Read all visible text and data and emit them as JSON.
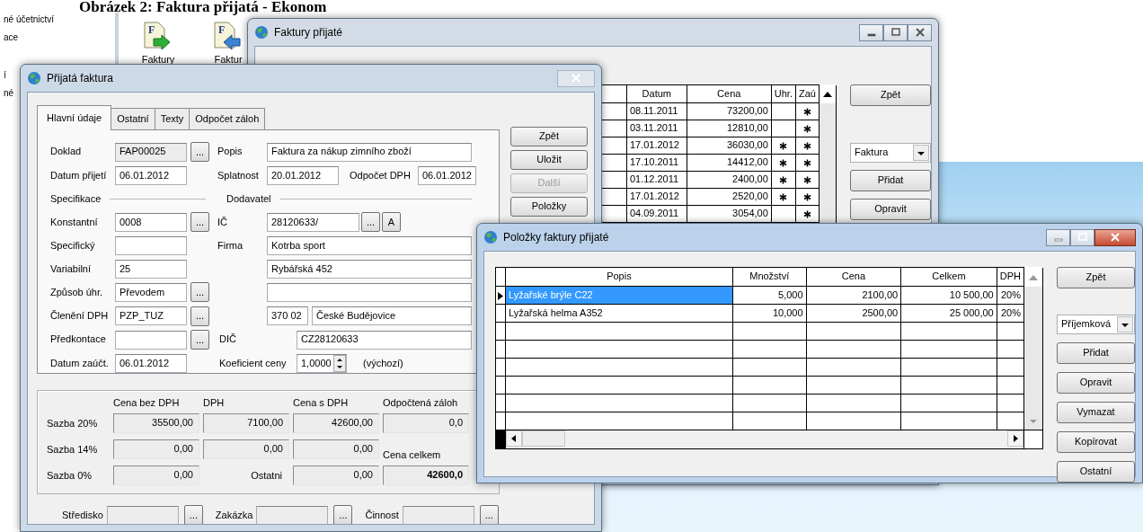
{
  "caption": "Obrázek 2: Faktura přijatá - Ekonom",
  "app": {
    "sidebar_items": [
      "né účetnictví",
      "ace",
      "í",
      "né"
    ],
    "toolbar": [
      {
        "label": "Faktury",
        "letter": "F",
        "kind": "out"
      },
      {
        "label": "Faktur",
        "letter": "F",
        "kind": "in"
      }
    ]
  },
  "invoices_window": {
    "title": "Faktury přijaté",
    "columns": [
      "Datum",
      "Cena",
      "Uhr.",
      "Zaú"
    ],
    "rows": [
      {
        "date": "08.11.2011",
        "price": "73200,00",
        "paid": false,
        "posted": true
      },
      {
        "date": "03.11.2011",
        "price": "12810,00",
        "paid": false,
        "posted": true
      },
      {
        "date": "17.01.2012",
        "price": "36030,00",
        "paid": true,
        "posted": true
      },
      {
        "date": "17.10.2011",
        "price": "14412,00",
        "paid": true,
        "posted": true
      },
      {
        "date": "01.12.2011",
        "price": "2400,00",
        "paid": true,
        "posted": true
      },
      {
        "date": "17.01.2012",
        "price": "2520,00",
        "paid": true,
        "posted": true
      },
      {
        "date": "04.09.2011",
        "price": "3054,00",
        "paid": false,
        "posted": true
      }
    ],
    "top_button": "Zpět",
    "type_select": "Faktura",
    "buttons": [
      "Přidat",
      "Opravit"
    ]
  },
  "invoice_dialog": {
    "title": "Přijatá faktura",
    "tabs": [
      {
        "label": "Hlavní údaje",
        "selected": true
      },
      {
        "label": "Ostatní",
        "selected": false
      },
      {
        "label": "Texty",
        "selected": false
      },
      {
        "label": "Odpočet záloh",
        "selected": false
      }
    ],
    "rows": [
      {
        "left": [
          {
            "kind": "label",
            "text": "Doklad"
          },
          {
            "kind": "field",
            "value": "FAP00025",
            "readonly": true
          },
          {
            "kind": "browse",
            "text": "..."
          }
        ],
        "right": [
          {
            "kind": "label",
            "text": "Popis"
          },
          {
            "kind": "field",
            "value": "Faktura za nákup zimního zboží"
          }
        ]
      },
      {
        "left": [
          {
            "kind": "label",
            "text": "Datum přijetí"
          },
          {
            "kind": "field",
            "value": "06.01.2012"
          }
        ],
        "right": [
          {
            "kind": "label",
            "text": "Splatnost"
          },
          {
            "kind": "field",
            "value": "20.01.2012"
          },
          {
            "kind": "label",
            "text": "Odpočet DPH"
          },
          {
            "kind": "field",
            "value": "06.01.2012"
          }
        ]
      },
      {
        "left": [
          {
            "kind": "section",
            "text": "Specifikace"
          }
        ],
        "right": [
          {
            "kind": "section",
            "text": "Dodavatel"
          }
        ]
      },
      {
        "left": [
          {
            "kind": "label",
            "text": "Konstantní"
          },
          {
            "kind": "field",
            "value": "0008"
          },
          {
            "kind": "browse",
            "text": "..."
          }
        ],
        "right": [
          {
            "kind": "label",
            "text": "IČ"
          },
          {
            "kind": "field",
            "value": "28120633/"
          },
          {
            "kind": "browse",
            "text": "..."
          },
          {
            "kind": "button",
            "text": "A"
          }
        ]
      },
      {
        "left": [
          {
            "kind": "label",
            "text": "Specifický"
          },
          {
            "kind": "field"
          }
        ],
        "right": [
          {
            "kind": "label",
            "text": "Firma"
          },
          {
            "kind": "field",
            "value": "Kotrba sport"
          }
        ]
      },
      {
        "left": [
          {
            "kind": "label",
            "text": "Variabilní"
          },
          {
            "kind": "field",
            "value": "25"
          }
        ],
        "right": [
          {
            "kind": "field",
            "value": "Rybářská 452"
          }
        ]
      },
      {
        "left": [
          {
            "kind": "label",
            "text": "Způsob úhr."
          },
          {
            "kind": "field",
            "value": "Převodem"
          },
          {
            "kind": "browse",
            "text": "..."
          }
        ],
        "right": [
          {
            "kind": "field"
          }
        ]
      },
      {
        "left": [
          {
            "kind": "label",
            "text": "Členění DPH"
          },
          {
            "kind": "field",
            "value": "PZP_TUZ"
          },
          {
            "kind": "browse",
            "text": "..."
          }
        ],
        "right": [
          {
            "kind": "field",
            "value": "370 02"
          },
          {
            "kind": "field",
            "value": "České Budějovice"
          }
        ]
      },
      {
        "left": [
          {
            "kind": "label",
            "text": "Předkontace"
          },
          {
            "kind": "field"
          },
          {
            "kind": "browse",
            "text": "..."
          }
        ],
        "right": [
          {
            "kind": "inline_label",
            "text": "DIČ"
          },
          {
            "kind": "field",
            "value": "CZ28120633"
          }
        ]
      },
      {
        "left": [
          {
            "kind": "label",
            "text": "Datum zaúčt."
          },
          {
            "kind": "field",
            "value": "06.01.2012"
          }
        ],
        "right": [
          {
            "kind": "inline_label",
            "text": "Koeficient ceny"
          },
          {
            "kind": "spin",
            "value": "1,0000"
          },
          {
            "kind": "note",
            "text": "(výchozí)"
          }
        ]
      }
    ],
    "summary": {
      "columns": [
        "Cena bez DPH",
        "DPH",
        "Cena s DPH",
        "Odpočtená záloh"
      ],
      "rows": [
        {
          "label": "Sazba 20%",
          "cells": [
            {
              "kind": "value",
              "text": "35500,00"
            },
            {
              "kind": "value",
              "text": "7100,00"
            },
            {
              "kind": "value",
              "text": "42600,00"
            },
            {
              "kind": "value",
              "text": "0,0"
            }
          ]
        },
        {
          "label": "Sazba 14%",
          "cells": [
            {
              "kind": "value",
              "text": "0,00"
            },
            {
              "kind": "value",
              "text": "0,00"
            },
            {
              "kind": "value",
              "text": "0,00"
            },
            {
              "kind": "caption",
              "text": "Cena celkem"
            }
          ]
        },
        {
          "label": "Sazba 0%",
          "cells": [
            {
              "kind": "value",
              "text": "0,00"
            },
            {
              "kind": "label_right",
              "text": "Ostatni"
            },
            {
              "kind": "value",
              "text": "0,00"
            },
            {
              "kind": "total",
              "text": "42600,0"
            }
          ]
        }
      ]
    },
    "cost_fields": [
      {
        "label": "Středisko",
        "readonly": true,
        "browse": "..."
      },
      {
        "label": "Zakázka",
        "readonly": true,
        "browse": "..."
      },
      {
        "label": "Činnost",
        "readonly": true,
        "browse": "..."
      }
    ],
    "buttons": [
      {
        "label": "Zpět",
        "disabled": false
      },
      {
        "label": "Uložit",
        "disabled": false
      },
      {
        "label": "Další",
        "disabled": true
      },
      {
        "label": "Položky",
        "disabled": false
      }
    ]
  },
  "items_window": {
    "title": "Položky faktury přijaté",
    "columns": [
      "Popis",
      "Množství",
      "Cena",
      "Celkem",
      "DPH"
    ],
    "rows": [
      {
        "cells": [
          "Lyžařské brýle C22",
          "5,000",
          "2100,00",
          "10 500,00",
          "20%"
        ],
        "selected": true
      },
      {
        "cells": [
          "Lyžařská helma A352",
          "10,000",
          "2500,00",
          "25 000,00",
          "20%"
        ],
        "selected": false
      }
    ],
    "top_button": "Zpět",
    "type_select": "Příjemková",
    "buttons": [
      "Přidat",
      "Opravit",
      "Vymazat",
      "Kopírovat",
      "Ostatní"
    ]
  }
}
